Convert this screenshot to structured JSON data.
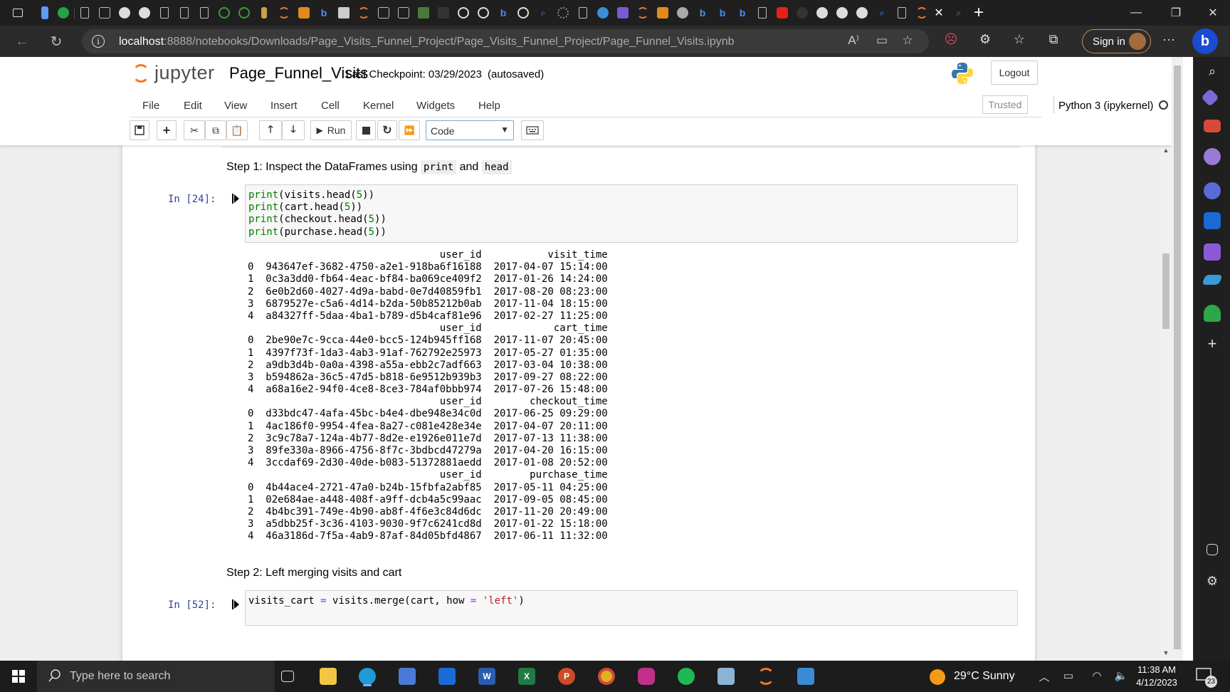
{
  "browser": {
    "url_host": "localhost",
    "url_path": ":8888/notebooks/Downloads/Page_Visits_Funnel_Project/Page_Visits_Funnel_Project/Page_Funnel_Visits.ipynb",
    "sign_in_label": "Sign in",
    "bing_label": "b",
    "tab_close": "✕",
    "new_tab": "+",
    "reader_aloud": "A⁾"
  },
  "jupyter": {
    "logo_text": "jupyter",
    "notebook_name": "Page_Funnel_Visits",
    "checkpoint_label": "Last Checkpoint: 03/29/2023",
    "autosave_status": "(autosaved)",
    "logout_label": "Logout",
    "menu": [
      "File",
      "Edit",
      "View",
      "Insert",
      "Cell",
      "Kernel",
      "Widgets",
      "Help"
    ],
    "trusted_label": "Trusted",
    "kernel_name": "Python 3 (ipykernel)",
    "toolbar": {
      "run_label": "Run",
      "cell_type": "Code"
    }
  },
  "cells": {
    "md1": {
      "prefix": "Step 1: Inspect the DataFrames using ",
      "code1": "print",
      "mid": " and ",
      "code2": "head"
    },
    "code1": {
      "prompt": "In [24]:",
      "lines": [
        {
          "fn": "print",
          "rest": "(visits.head(",
          "num": "5",
          "end": "))"
        },
        {
          "fn": "print",
          "rest": "(cart.head(",
          "num": "5",
          "end": "))"
        },
        {
          "fn": "print",
          "rest": "(checkout.head(",
          "num": "5",
          "end": "))"
        },
        {
          "fn": "print",
          "rest": "(purchase.head(",
          "num": "5",
          "end": "))"
        }
      ],
      "output": [
        "                                user_id           visit_time",
        "0  943647ef-3682-4750-a2e1-918ba6f16188  2017-04-07 15:14:00",
        "1  0c3a3dd0-fb64-4eac-bf84-ba069ce409f2  2017-01-26 14:24:00",
        "2  6e0b2d60-4027-4d9a-babd-0e7d40859fb1  2017-08-20 08:23:00",
        "3  6879527e-c5a6-4d14-b2da-50b85212b0ab  2017-11-04 18:15:00",
        "4  a84327ff-5daa-4ba1-b789-d5b4caf81e96  2017-02-27 11:25:00",
        "                                user_id            cart_time",
        "0  2be90e7c-9cca-44e0-bcc5-124b945ff168  2017-11-07 20:45:00",
        "1  4397f73f-1da3-4ab3-91af-762792e25973  2017-05-27 01:35:00",
        "2  a9db3d4b-0a0a-4398-a55a-ebb2c7adf663  2017-03-04 10:38:00",
        "3  b594862a-36c5-47d5-b818-6e9512b939b3  2017-09-27 08:22:00",
        "4  a68a16e2-94f0-4ce8-8ce3-784af0bbb974  2017-07-26 15:48:00",
        "                                user_id        checkout_time",
        "0  d33bdc47-4afa-45bc-b4e4-dbe948e34c0d  2017-06-25 09:29:00",
        "1  4ac186f0-9954-4fea-8a27-c081e428e34e  2017-04-07 20:11:00",
        "2  3c9c78a7-124a-4b77-8d2e-e1926e011e7d  2017-07-13 11:38:00",
        "3  89fe330a-8966-4756-8f7c-3bdbcd47279a  2017-04-20 16:15:00",
        "4  3ccdaf69-2d30-40de-b083-51372881aedd  2017-01-08 20:52:00",
        "                                user_id        purchase_time",
        "0  4b44ace4-2721-47a0-b24b-15fbfa2abf85  2017-05-11 04:25:00",
        "1  02e684ae-a448-408f-a9ff-dcb4a5c99aac  2017-09-05 08:45:00",
        "2  4b4bc391-749e-4b90-ab8f-4f6e3c84d6dc  2017-11-20 20:49:00",
        "3  a5dbb25f-3c36-4103-9030-9f7c6241cd8d  2017-01-22 15:18:00",
        "4  46a3186d-7f5a-4ab9-87af-84d05bfd4867  2017-06-11 11:32:00"
      ]
    },
    "md2": {
      "text": "Step 2: Left merging visits and cart"
    },
    "code2": {
      "prompt": "In [52]:",
      "line_a": "visits_cart ",
      "line_eq": "=",
      "line_b": " visits.merge(cart, how ",
      "line_eq2": "=",
      "line_str": " 'left'",
      "line_end": ")"
    }
  },
  "taskbar": {
    "search_placeholder": "Type here to search",
    "weather": "29°C  Sunny",
    "time": "11:38 AM",
    "date": "4/12/2023",
    "notification_count": "23"
  },
  "colors": {
    "jupyter_orange": "#f37726",
    "prompt_blue": "#303f9f",
    "python_keyword_green": "#008000",
    "string_red": "#ba2121"
  }
}
